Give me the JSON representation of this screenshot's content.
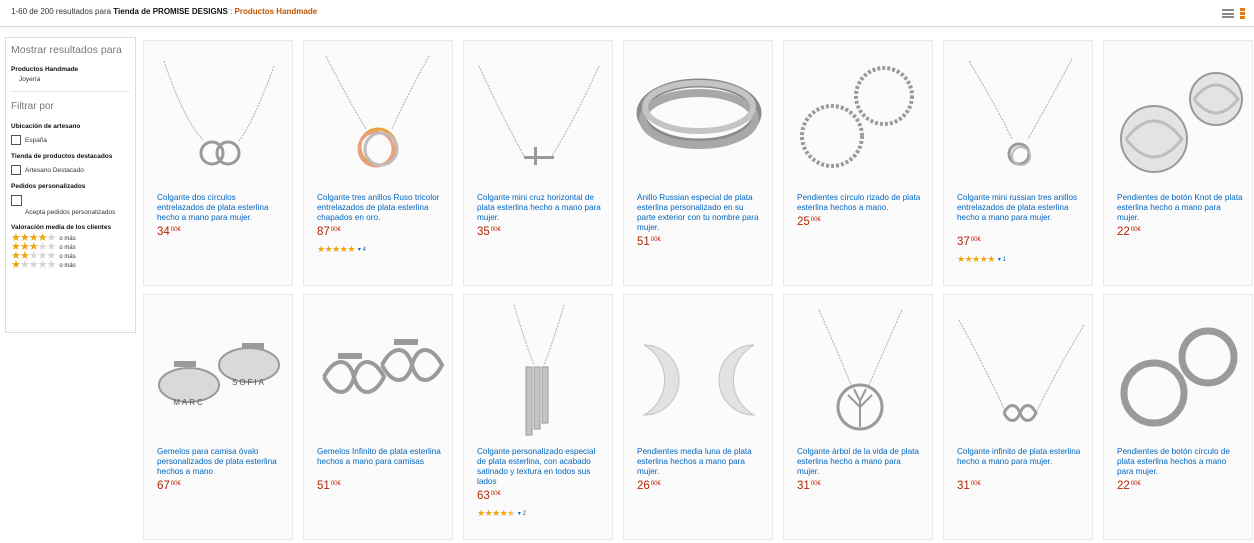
{
  "header": {
    "results_prefix": "1-60 de 200 resultados para ",
    "store": "Tienda de PROMISE DESIGNS",
    "separator": " : ",
    "category": "Productos Handmade"
  },
  "sidebar": {
    "show_results_title": "Mostrar resultados para",
    "department": "Productos Handmade",
    "subdepartment": "Joyería",
    "filter_title": "Filtrar por",
    "groups": [
      {
        "title": "Ubicación de artesano",
        "option": "España"
      },
      {
        "title": "Tienda de productos destacados",
        "option": "Artesano Destacado"
      },
      {
        "title": "Pedidos personalizados",
        "option": "Acepta pedidos personalizados"
      }
    ],
    "rating_title": "Valoración media de los clientes",
    "rating_filters": [
      {
        "stars": 4,
        "suffix": "o más"
      },
      {
        "stars": 3,
        "suffix": "o más"
      },
      {
        "stars": 2,
        "suffix": "o más"
      },
      {
        "stars": 1,
        "suffix": "o más"
      }
    ]
  },
  "products": [
    {
      "title": "Colgante dos círculos entrelazados de plata esterlina hecho a mano para mujer.",
      "price_int": "34",
      "price_dec": "00",
      "currency": "€",
      "img": "necklace-two-circles"
    },
    {
      "title": "Colgante tres anillos Ruso tricolor entrelazados de plata esterlina chapados en oro.",
      "price_int": "87",
      "price_dec": "00",
      "currency": "€",
      "rating": 5,
      "reviews": "4",
      "img": "necklace-russian-tricolor"
    },
    {
      "title": "Colgante mini cruz horizontal de plata esterlina hecho a mano para mujer.",
      "price_int": "35",
      "price_dec": "00",
      "currency": "€",
      "img": "necklace-cross"
    },
    {
      "title": "Anillo Russian especial de plata esterlina personalizado en su parte exterior con tu nombre para mujer.",
      "price_int": "51",
      "price_dec": "00",
      "currency": "€",
      "img": "ring-russian"
    },
    {
      "title": "Pendientes círculo rizado de plata esterlina hechos a mano.",
      "price_int": "25",
      "price_dec": "00",
      "currency": "€",
      "img": "earrings-twisted-circle"
    },
    {
      "title": "Colgante mini russian tres anillos entrelazados de plata esterlina hecho a mano para mujer.",
      "price_int": "37",
      "price_dec": "00",
      "currency": "€",
      "rating": 5,
      "reviews": "1",
      "img": "necklace-mini-russian"
    },
    {
      "title": "Pendientes de botón Knot de plata esterlina hecho a mano para mujer.",
      "price_int": "22",
      "price_dec": "00",
      "currency": "€",
      "img": "earrings-knot"
    },
    {
      "title": "Gemelos para camisa óvalo personalizados de plata esterlina hechos a mano",
      "price_int": "67",
      "price_dec": "00",
      "currency": "€",
      "img": "cufflinks-oval",
      "engrave1": "MARC",
      "engrave2": "SOFIA"
    },
    {
      "title": "Gemelos Infinito de plata esterlina hechos a mano para camisas",
      "price_int": "51",
      "price_dec": "00",
      "currency": "€",
      "img": "cufflinks-infinity"
    },
    {
      "title": "Colgante personalizado especial de plata esterlina, con acabado satinado y textura en todos sus lados",
      "price_int": "63",
      "price_dec": "00",
      "currency": "€",
      "rating": 4.5,
      "reviews": "2",
      "img": "necklace-bars"
    },
    {
      "title": "Pendientes media luna de plata esterlina hechos a mano para mujer.",
      "price_int": "26",
      "price_dec": "00",
      "currency": "€",
      "img": "earrings-moon"
    },
    {
      "title": "Colgante árbol de la vida de plata esterlina hecho a mano para mujer.",
      "price_int": "31",
      "price_dec": "00",
      "currency": "€",
      "img": "necklace-tree"
    },
    {
      "title": "Colgante infinito de plata esterlina hecho a mano para mujer.",
      "price_int": "31",
      "price_dec": "00",
      "currency": "€",
      "img": "necklace-infinity"
    },
    {
      "title": "Pendientes de botón círculo de plata esterlina hechos a mano para mujer.",
      "price_int": "22",
      "price_dec": "00",
      "currency": "€",
      "img": "earrings-circle-stud"
    }
  ],
  "colors": {
    "link": "#0066c0",
    "price": "#b12704",
    "star": "#f0a30a",
    "accent": "#c45500"
  },
  "icons": {
    "list_view": "list-view-icon",
    "grid_view": "grid-view-icon"
  }
}
